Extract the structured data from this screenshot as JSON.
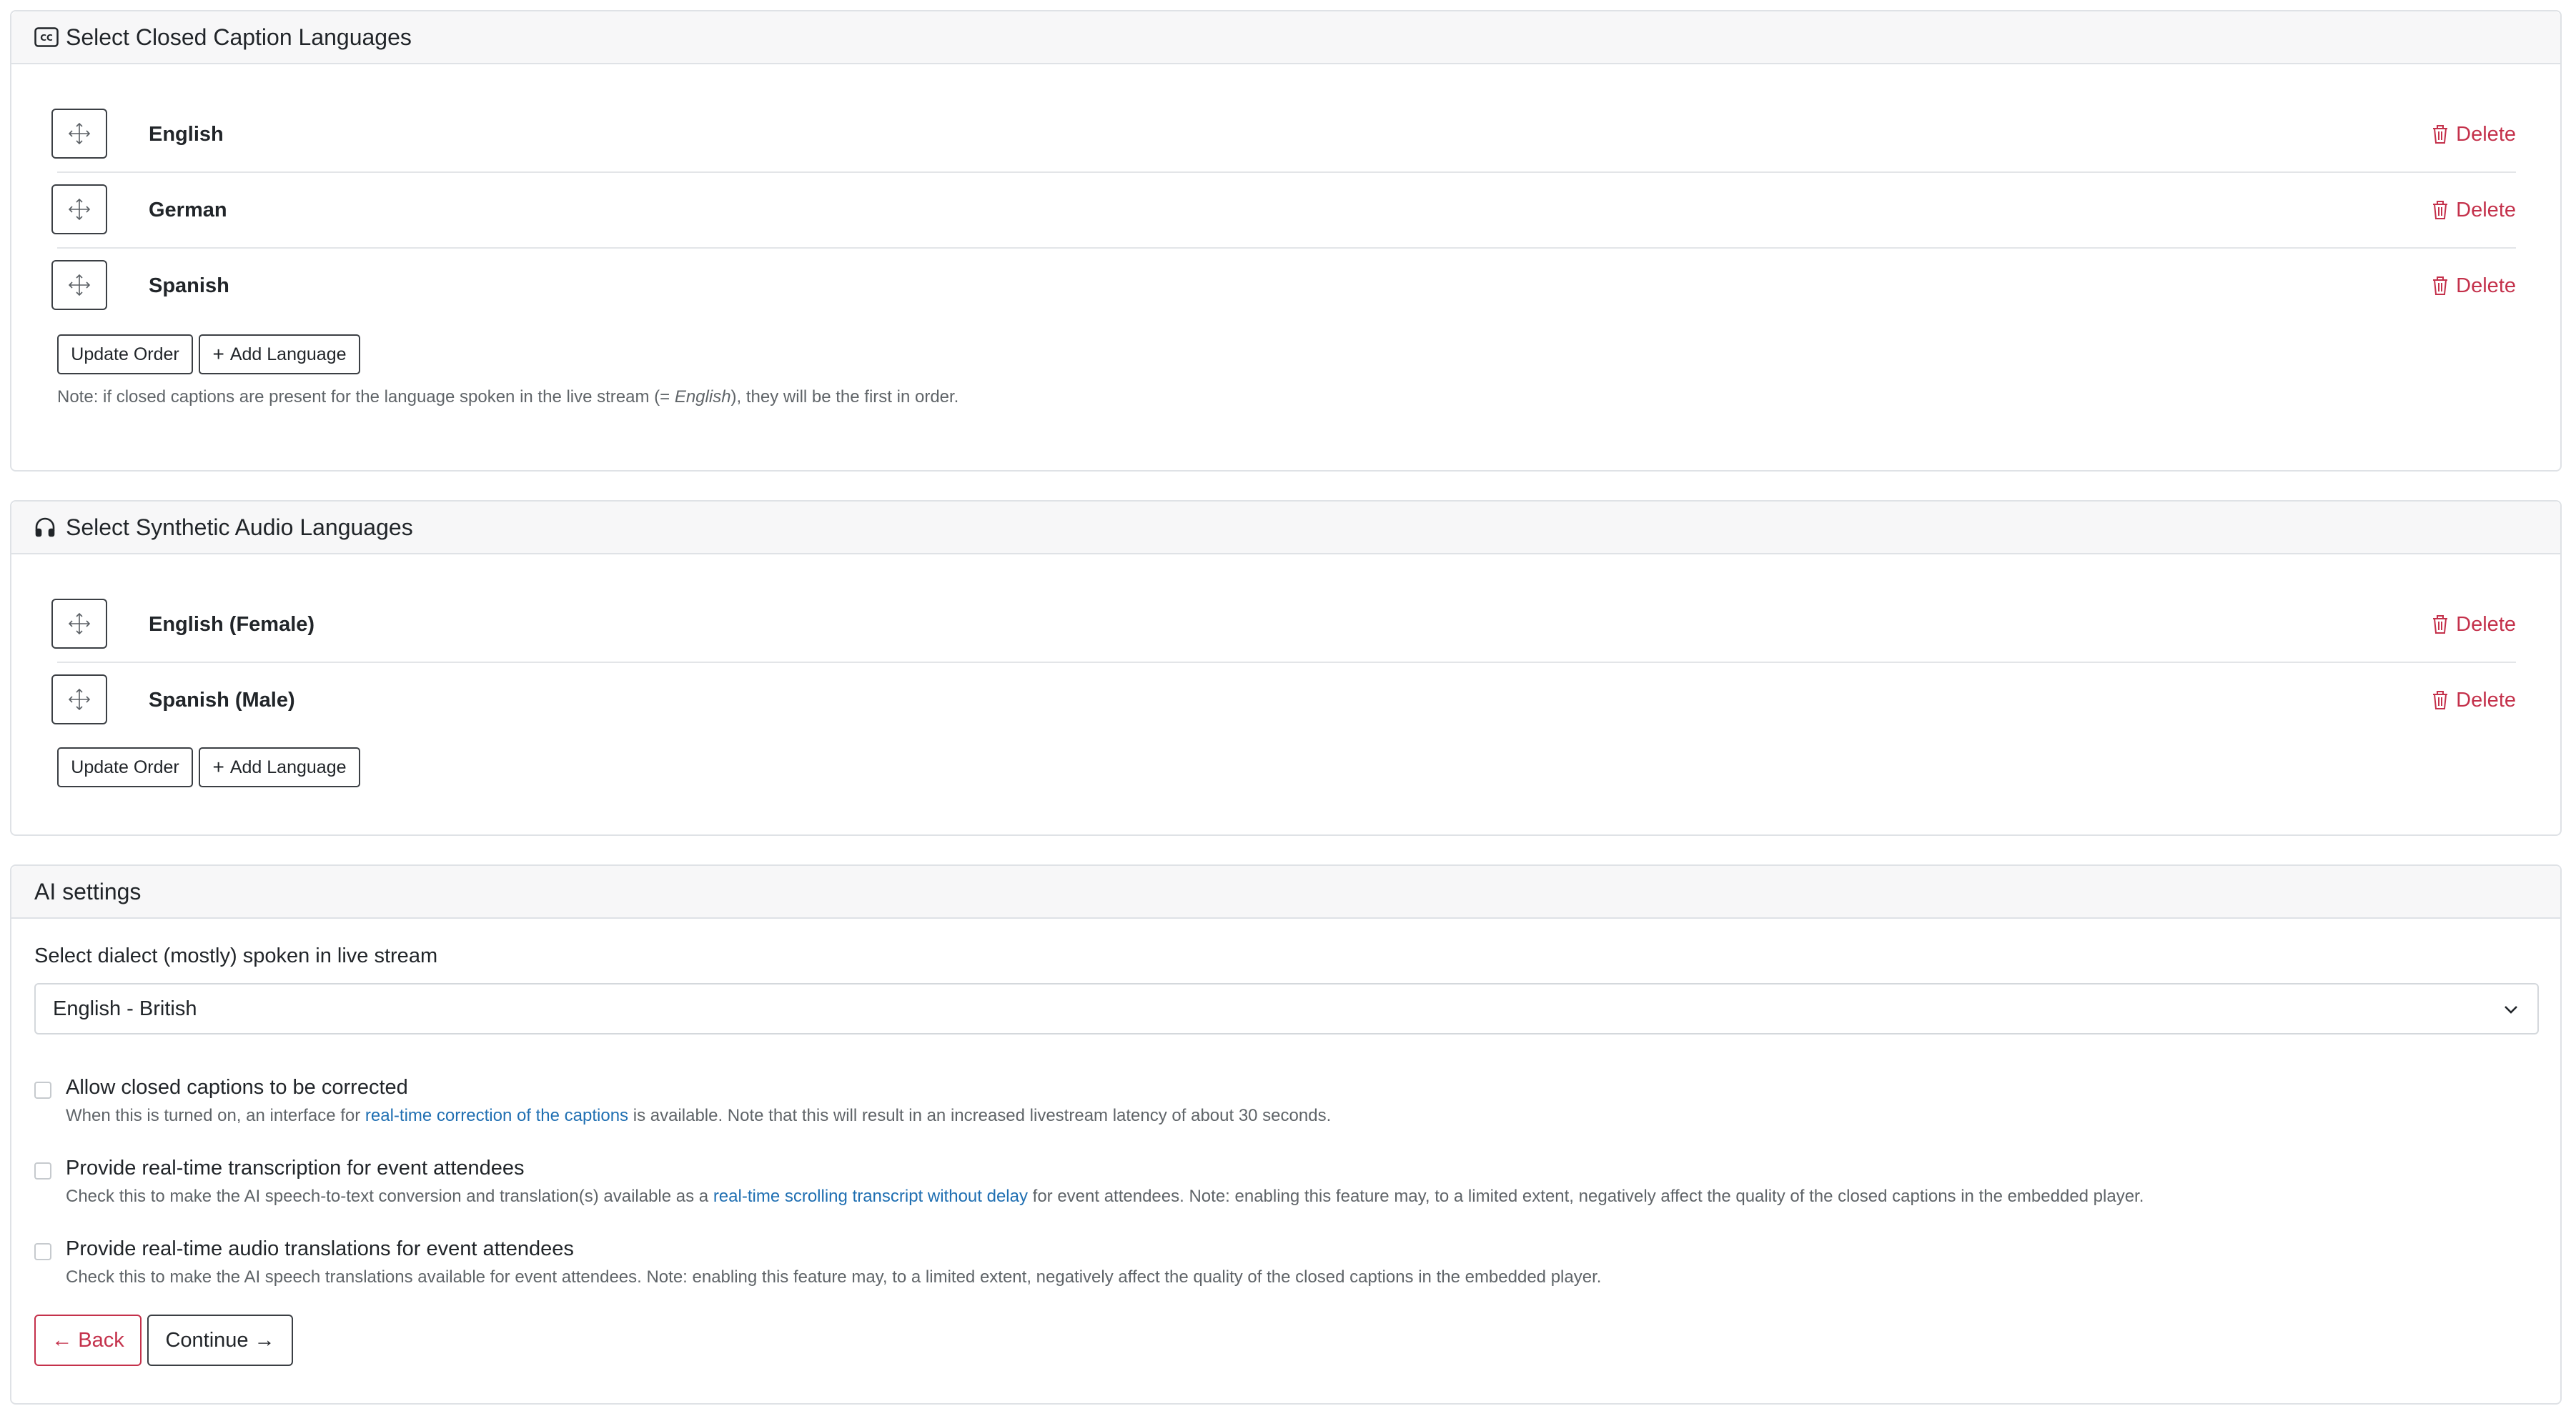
{
  "captions": {
    "title": "Select Closed Caption Languages",
    "header_icon": "cc-icon",
    "languages": [
      "English",
      "German",
      "Spanish"
    ],
    "delete_label": "Delete",
    "update_order_label": "Update Order",
    "add_language_label": "Add Language",
    "note_before": "Note: if closed captions are present for the language spoken in the live stream (= ",
    "note_lang": "English",
    "note_after": "), they will be the first in order."
  },
  "audio": {
    "title": "Select Synthetic Audio Languages",
    "header_icon": "headphones-icon",
    "languages": [
      "English (Female)",
      "Spanish (Male)"
    ],
    "delete_label": "Delete",
    "update_order_label": "Update Order",
    "add_language_label": "Add Language"
  },
  "ai": {
    "title": "AI settings",
    "dialect_label": "Select dialect (mostly) spoken in live stream",
    "dialect_value": "English - British",
    "options": [
      {
        "title": "Allow closed captions to be corrected",
        "desc_before": "When this is turned on, an interface for ",
        "link": "real-time correction of the captions",
        "desc_after": " is available. Note that this will result in an increased livestream latency of about 30 seconds.",
        "checked": false
      },
      {
        "title": "Provide real-time transcription for event attendees",
        "desc_before": "Check this to make the AI speech-to-text conversion and translation(s) available as a ",
        "link": "real-time scrolling transcript without delay",
        "desc_after": " for event attendees. Note: enabling this feature may, to a limited extent, negatively affect the quality of the closed captions in the embedded player.",
        "checked": false
      },
      {
        "title": "Provide real-time audio translations for event attendees",
        "desc_before": "Check this to make the AI speech translations available for event attendees. Note: enabling this feature may, to a limited extent, negatively affect the quality of the closed captions in the embedded player.",
        "link": "",
        "desc_after": "",
        "checked": false
      }
    ],
    "back_label": "Back",
    "continue_label": "Continue"
  },
  "colors": {
    "danger": "#c4314b",
    "link": "#1f6fb2",
    "border": "#dfe2e6",
    "header_bg": "#f7f7f8"
  }
}
